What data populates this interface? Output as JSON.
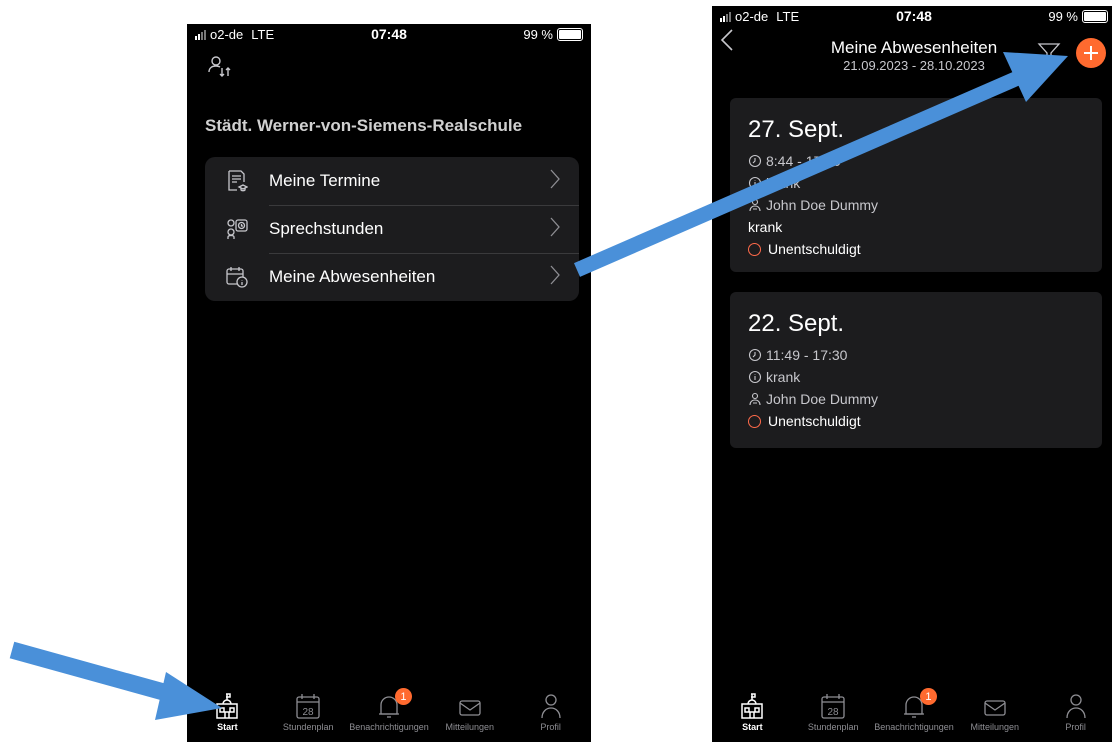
{
  "status_left": {
    "carrier": "o2-de",
    "network": "LTE",
    "time": "07:48",
    "battery": "99 %"
  },
  "status_right": {
    "carrier": "o2-de",
    "network": "LTE",
    "time": "07:48",
    "battery": "99 %"
  },
  "start": {
    "school_name": "Städt. Werner-von-Siemens-Realschule",
    "menu": [
      {
        "label": "Meine Termine",
        "icon": "appointments-icon"
      },
      {
        "label": "Sprechstunden",
        "icon": "consultation-hours-icon"
      },
      {
        "label": "Meine Abwesenheiten",
        "icon": "absence-calendar-icon"
      }
    ]
  },
  "absences": {
    "title": "Meine Abwesenheiten",
    "range": "21.09.2023 - 28.10.2023",
    "cards": [
      {
        "date": "27. Sept.",
        "time": "8:44 - 17:30",
        "reason": "krank",
        "person": "John Doe Dummy",
        "note": "krank",
        "status": "Unentschuldigt"
      },
      {
        "date": "22. Sept.",
        "time": "11:49 - 17:30",
        "reason": "krank",
        "person": "John Doe Dummy",
        "status": "Unentschuldigt"
      }
    ]
  },
  "tabbar": {
    "tabs": [
      {
        "label": "Start",
        "icon": "school-icon"
      },
      {
        "label": "Stundenplan",
        "icon": "calendar-icon",
        "icon_text": "28"
      },
      {
        "label": "Benachrichtigungen",
        "icon": "bell-icon",
        "badge": "1"
      },
      {
        "label": "Mitteilungen",
        "icon": "envelope-icon"
      },
      {
        "label": "Profil",
        "icon": "person-icon"
      }
    ]
  },
  "colors": {
    "accent": "#ff6a2f",
    "arrow": "#4a90d9",
    "card": "#1c1c1e",
    "background": "#000000"
  }
}
